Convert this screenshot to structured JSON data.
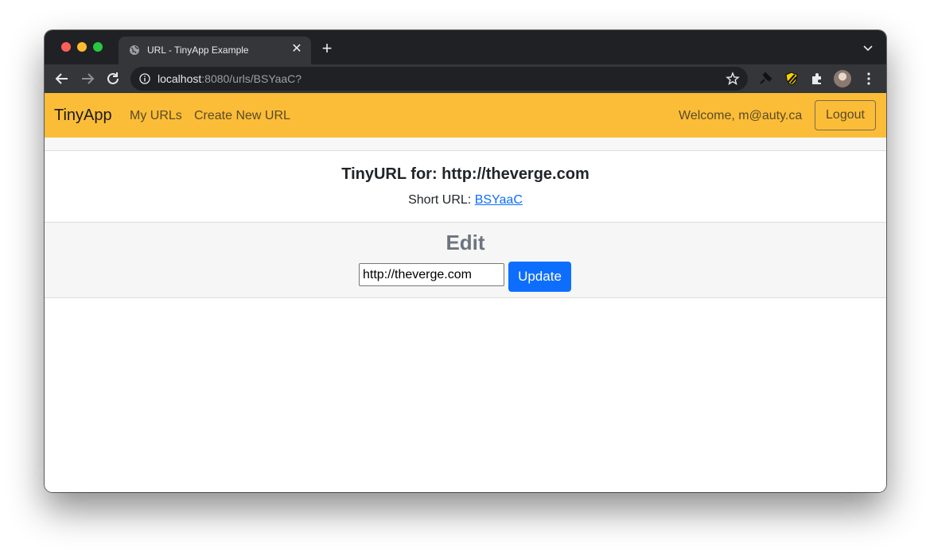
{
  "browser": {
    "tab_title": "URL - TinyApp Example",
    "tab_close": "✕",
    "new_tab": "+",
    "url_host": "localhost",
    "url_rest": ":8080/urls/BSYaaC?"
  },
  "navbar": {
    "brand": "TinyApp",
    "links": [
      "My URLs",
      "Create New URL"
    ],
    "welcome": "Welcome, m@auty.ca",
    "logout_label": "Logout",
    "color": "#fbbd37"
  },
  "card": {
    "title": "TinyURL for: http://theverge.com",
    "short_label": "Short URL: ",
    "short_link": "BSYaaC"
  },
  "edit": {
    "title": "Edit",
    "input_value": "http://theverge.com",
    "update_label": "Update",
    "button_color": "#0d6efd"
  },
  "icons": {
    "tab": "globe-icon",
    "toolbar": [
      "back-icon",
      "forward-icon",
      "reload-icon",
      "info-icon",
      "star-icon",
      "pin-extension-icon",
      "extension-badge-icon",
      "puzzle-icon",
      "kebab-menu-icon"
    ]
  }
}
